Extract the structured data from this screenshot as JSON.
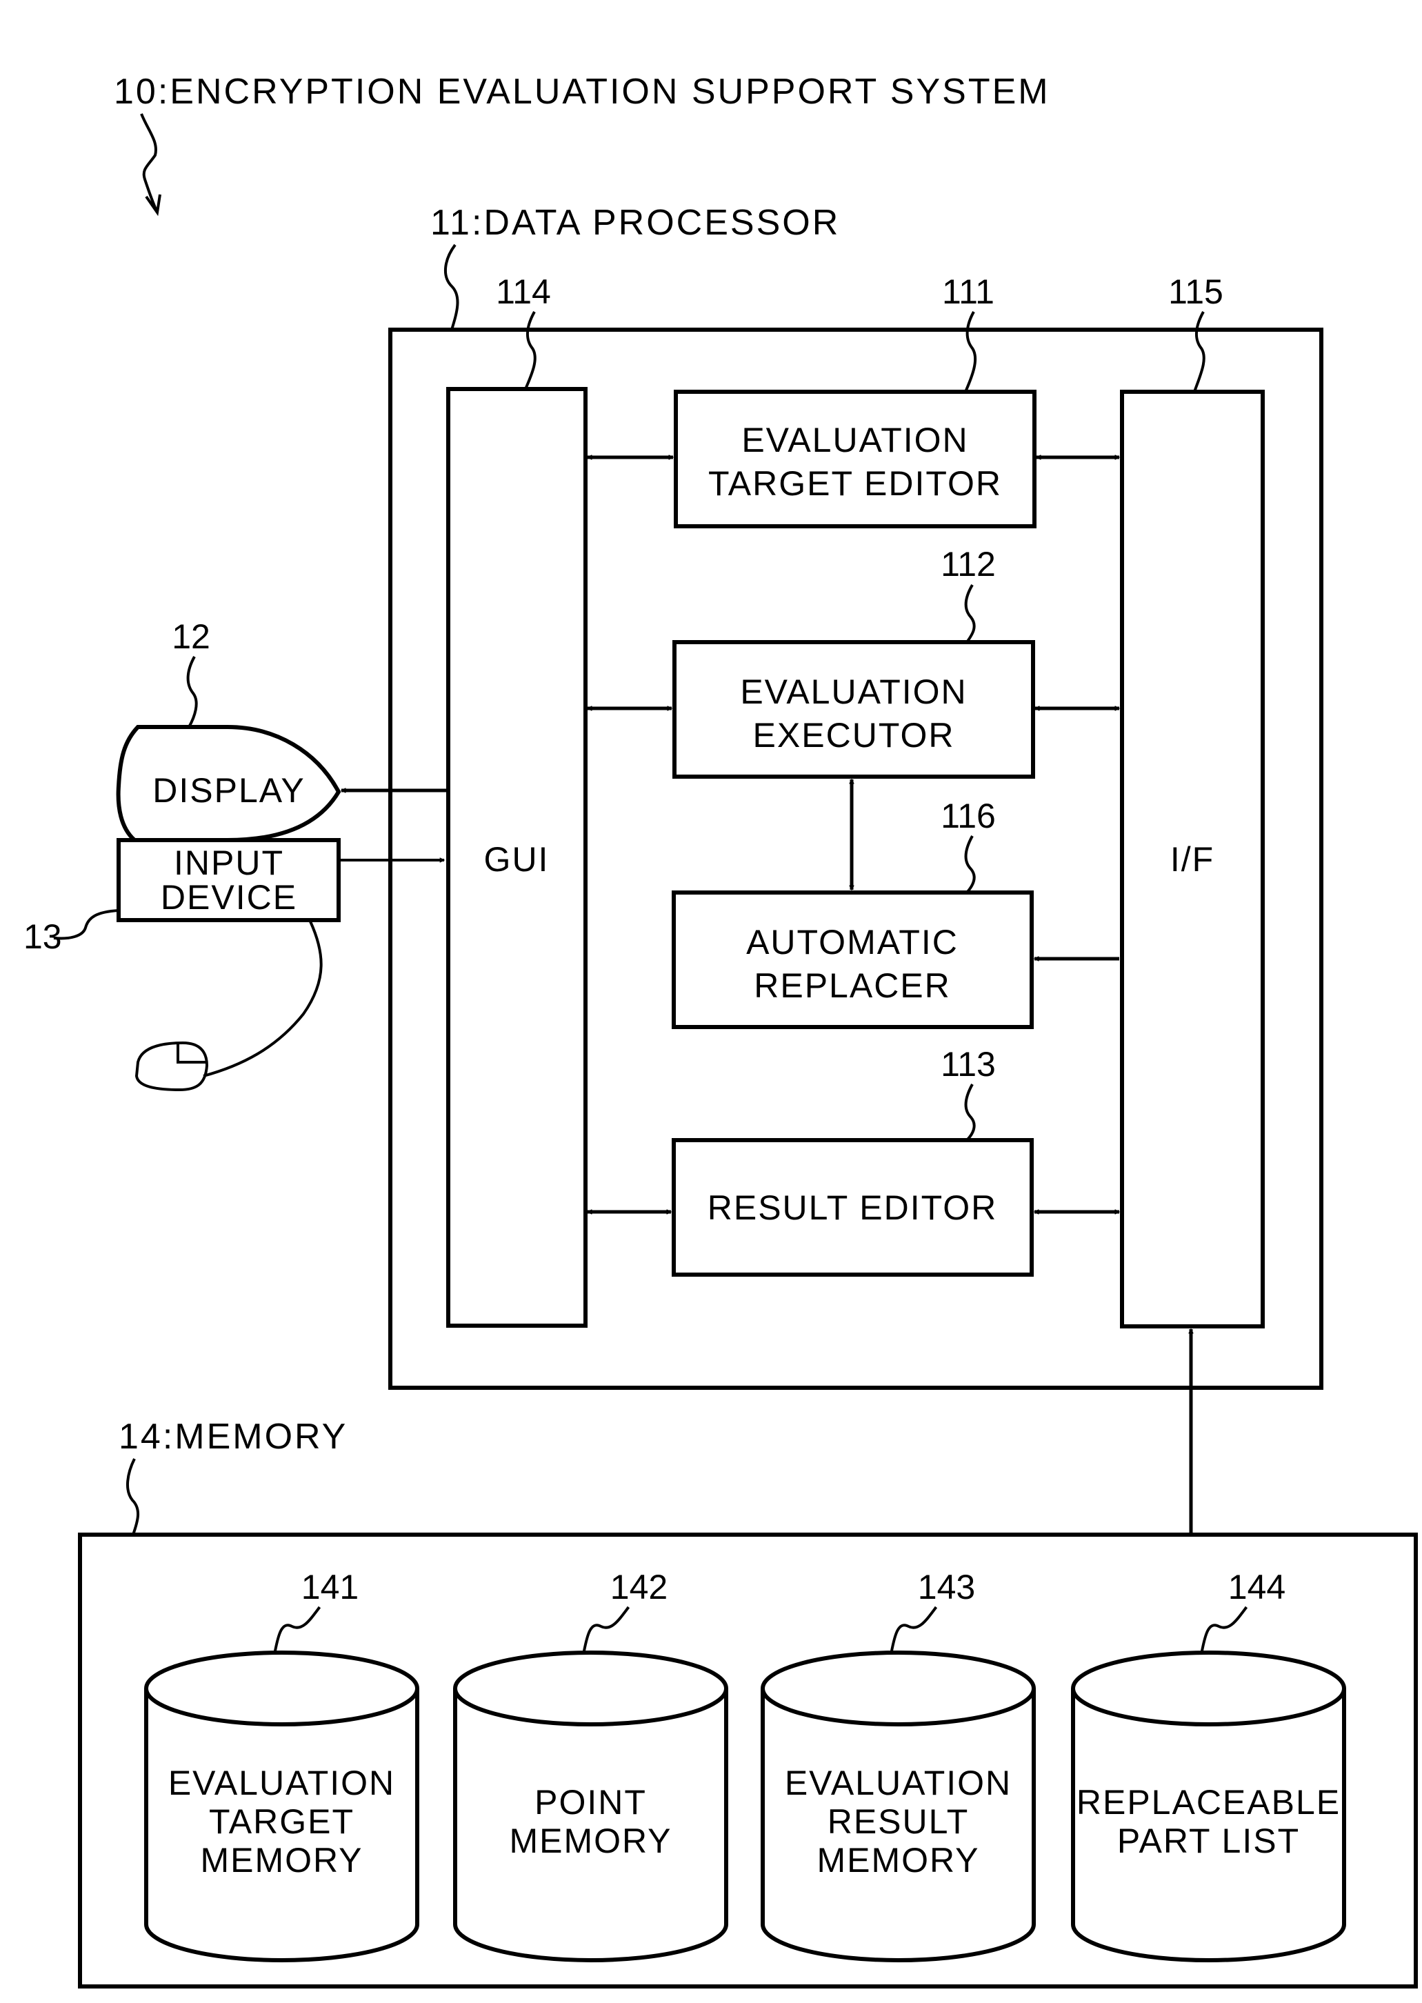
{
  "title": "10:ENCRYPTION EVALUATION SUPPORT SYSTEM",
  "data_processor": {
    "label": "11:DATA PROCESSOR",
    "gui": {
      "ref": "114",
      "label": "GUI"
    },
    "interface": {
      "ref": "115",
      "label": "I/F"
    },
    "evaluation_target_editor": {
      "ref": "111",
      "line1": "EVALUATION",
      "line2": "TARGET EDITOR"
    },
    "evaluation_executor": {
      "ref": "112",
      "line1": "EVALUATION",
      "line2": "EXECUTOR"
    },
    "automatic_replacer": {
      "ref": "116",
      "line1": "AUTOMATIC",
      "line2": "REPLACER"
    },
    "result_editor": {
      "ref": "113",
      "line1": "RESULT EDITOR"
    }
  },
  "display": {
    "ref": "12",
    "label": "DISPLAY"
  },
  "input_device": {
    "ref": "13",
    "line1": "INPUT",
    "line2": "DEVICE"
  },
  "memory": {
    "label": "14:MEMORY",
    "stores": [
      {
        "ref": "141",
        "lines": [
          "EVALUATION",
          "TARGET",
          "MEMORY"
        ]
      },
      {
        "ref": "142",
        "lines": [
          "POINT",
          "MEMORY"
        ]
      },
      {
        "ref": "143",
        "lines": [
          "EVALUATION",
          "RESULT",
          "MEMORY"
        ]
      },
      {
        "ref": "144",
        "lines": [
          "REPLACEABLE",
          "PART LIST"
        ]
      }
    ]
  }
}
